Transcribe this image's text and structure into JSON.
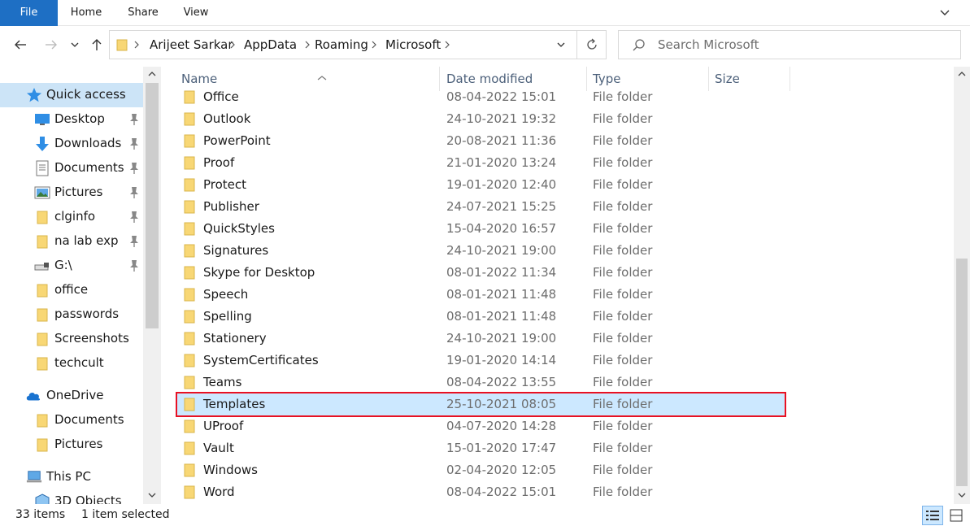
{
  "ribbon": {
    "tabs": [
      "File",
      "Home",
      "Share",
      "View"
    ]
  },
  "address": {
    "crumbs": [
      "Arijeet Sarkar",
      "AppData",
      "Roaming",
      "Microsoft"
    ]
  },
  "search": {
    "placeholder": "Search Microsoft"
  },
  "sidebar": {
    "items": [
      {
        "label": "Quick access",
        "icon": "star-icon"
      },
      {
        "label": "Desktop",
        "icon": "desktop-icon",
        "pinned": true
      },
      {
        "label": "Downloads",
        "icon": "download-icon",
        "pinned": true
      },
      {
        "label": "Documents",
        "icon": "documents-icon",
        "pinned": true
      },
      {
        "label": "Pictures",
        "icon": "pictures-icon",
        "pinned": true
      },
      {
        "label": "clginfo",
        "icon": "folder-icon",
        "pinned": true
      },
      {
        "label": "na lab exp",
        "icon": "folder-icon",
        "pinned": true
      },
      {
        "label": "G:\\",
        "icon": "drive-icon",
        "pinned": true
      },
      {
        "label": "office",
        "icon": "folder-icon"
      },
      {
        "label": "passwords",
        "icon": "folder-icon"
      },
      {
        "label": "Screenshots",
        "icon": "folder-icon"
      },
      {
        "label": "techcult",
        "icon": "folder-icon"
      },
      {
        "label": "OneDrive",
        "icon": "cloud-icon"
      },
      {
        "label": "Documents",
        "icon": "folder-icon"
      },
      {
        "label": "Pictures",
        "icon": "folder-icon"
      },
      {
        "label": "This PC",
        "icon": "computer-icon"
      },
      {
        "label": "3D Objects",
        "icon": "cube-icon"
      }
    ]
  },
  "columns": {
    "name": "Name",
    "date": "Date modified",
    "type": "Type",
    "size": "Size"
  },
  "files": [
    {
      "name": "Office",
      "date": "08-04-2022 15:01",
      "type": "File folder"
    },
    {
      "name": "Outlook",
      "date": "24-10-2021 19:32",
      "type": "File folder"
    },
    {
      "name": "PowerPoint",
      "date": "20-08-2021 11:36",
      "type": "File folder"
    },
    {
      "name": "Proof",
      "date": "21-01-2020 13:24",
      "type": "File folder"
    },
    {
      "name": "Protect",
      "date": "19-01-2020 12:40",
      "type": "File folder"
    },
    {
      "name": "Publisher",
      "date": "24-07-2021 15:25",
      "type": "File folder"
    },
    {
      "name": "QuickStyles",
      "date": "15-04-2020 16:57",
      "type": "File folder"
    },
    {
      "name": "Signatures",
      "date": "24-10-2021 19:00",
      "type": "File folder"
    },
    {
      "name": "Skype for Desktop",
      "date": "08-01-2022 11:34",
      "type": "File folder"
    },
    {
      "name": "Speech",
      "date": "08-01-2021 11:48",
      "type": "File folder"
    },
    {
      "name": "Spelling",
      "date": "08-01-2021 11:48",
      "type": "File folder"
    },
    {
      "name": "Stationery",
      "date": "24-10-2021 19:00",
      "type": "File folder"
    },
    {
      "name": "SystemCertificates",
      "date": "19-01-2020 14:14",
      "type": "File folder"
    },
    {
      "name": "Teams",
      "date": "08-04-2022 13:55",
      "type": "File folder"
    },
    {
      "name": "Templates",
      "date": "25-10-2021 08:05",
      "type": "File folder",
      "selected": true
    },
    {
      "name": "UProof",
      "date": "04-07-2020 14:28",
      "type": "File folder"
    },
    {
      "name": "Vault",
      "date": "15-01-2020 17:47",
      "type": "File folder"
    },
    {
      "name": "Windows",
      "date": "02-04-2020 12:05",
      "type": "File folder"
    },
    {
      "name": "Word",
      "date": "08-04-2022 15:01",
      "type": "File folder"
    }
  ],
  "status": {
    "count": "33 items",
    "selection": "1 item selected"
  },
  "colors": {
    "file_tab": "#1e6fc4",
    "selection": "#cce8ff",
    "highlight_border": "#e81123",
    "folder": "#f8d775"
  }
}
